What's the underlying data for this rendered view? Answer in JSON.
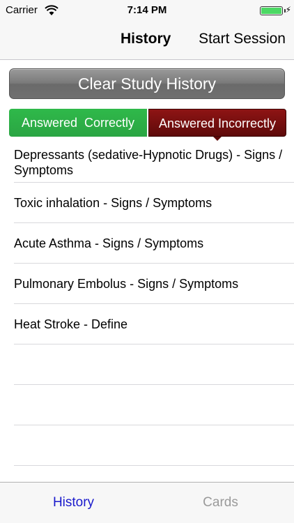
{
  "status_bar": {
    "carrier": "Carrier",
    "time": "7:14 PM",
    "battery_level": 1.0
  },
  "nav": {
    "title": "History",
    "action": "Start Session"
  },
  "clear_button": {
    "label": "Clear Study History"
  },
  "segments": {
    "correct": "Answered  Correctly",
    "incorrect": "Answered Incorrectly",
    "selected": "incorrect"
  },
  "items": [
    "Depressants (sedative-Hypnotic Drugs) - Signs / Symptoms",
    "Toxic inhalation - Signs / Symptoms",
    "Acute Asthma - Signs / Symptoms",
    "Pulmonary Embolus - Signs / Symptoms",
    "Heat Stroke - Define",
    "",
    "",
    ""
  ],
  "tabs": {
    "history": "History",
    "cards": "Cards"
  },
  "colors": {
    "correct_green": "#2aa543",
    "incorrect_red": "#6e0d0d",
    "active_tab": "#1a1acc",
    "inactive_tab": "#9a9a9a",
    "battery": "#4cd964"
  }
}
